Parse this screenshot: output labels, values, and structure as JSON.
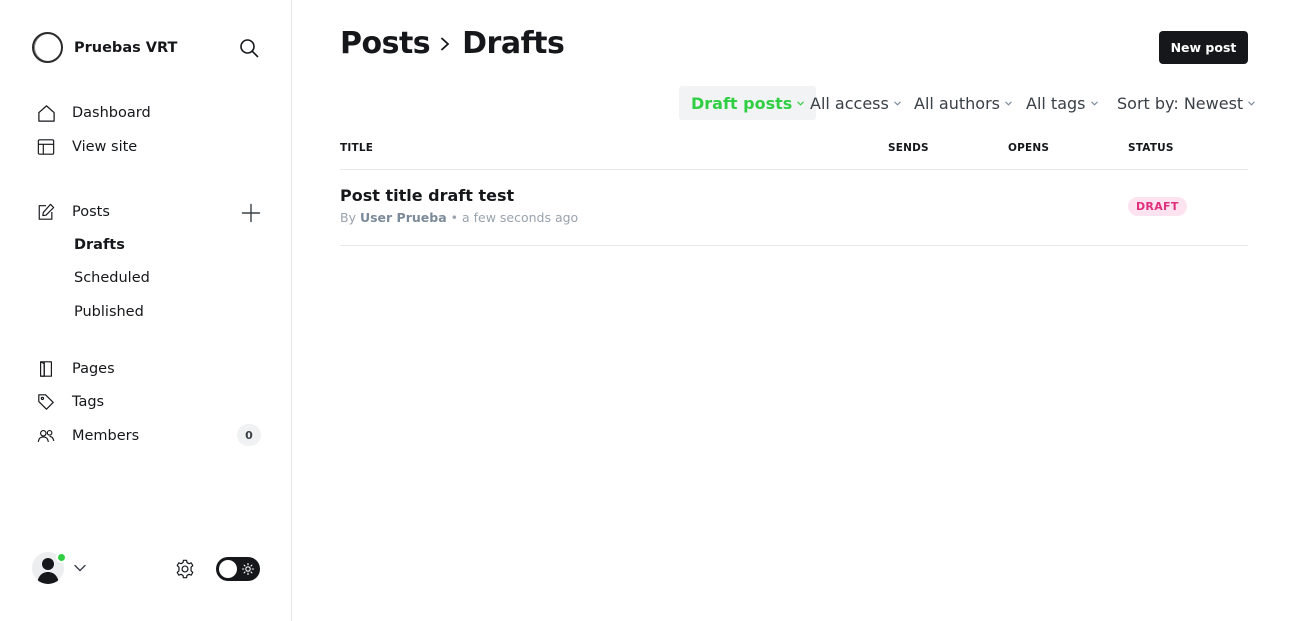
{
  "brand": {
    "name": "Pruebas VRT"
  },
  "sidebar": {
    "nav": [
      {
        "label": "Dashboard",
        "icon": "home-icon"
      },
      {
        "label": "View site",
        "icon": "layout-icon"
      }
    ],
    "posts": {
      "label": "Posts",
      "icon": "edit-icon"
    },
    "post_subnav": [
      {
        "label": "Drafts",
        "active": true
      },
      {
        "label": "Scheduled"
      },
      {
        "label": "Published"
      }
    ],
    "content_nav": [
      {
        "label": "Pages",
        "icon": "page-icon"
      },
      {
        "label": "Tags",
        "icon": "tag-icon"
      },
      {
        "label": "Members",
        "icon": "members-icon"
      }
    ],
    "members_count": "0"
  },
  "header": {
    "crumb_parent": "Posts",
    "crumb_current": "Drafts",
    "new_post_label": "New post"
  },
  "filters": [
    {
      "label": "Draft posts",
      "active": true
    },
    {
      "label": "All access"
    },
    {
      "label": "All authors"
    },
    {
      "label": "All tags"
    },
    {
      "label": "Sort by: Newest"
    }
  ],
  "table": {
    "columns": [
      "TITLE",
      "SENDS",
      "OPENS",
      "STATUS"
    ],
    "rows": [
      {
        "title": "Post title draft test",
        "by": "By",
        "author": "User Prueba",
        "time": "• a few seconds ago",
        "status": "DRAFT"
      }
    ]
  },
  "colors": {
    "accent_green": "#30cf43",
    "draft_pink": "#e0307d",
    "dark": "#15171a"
  }
}
